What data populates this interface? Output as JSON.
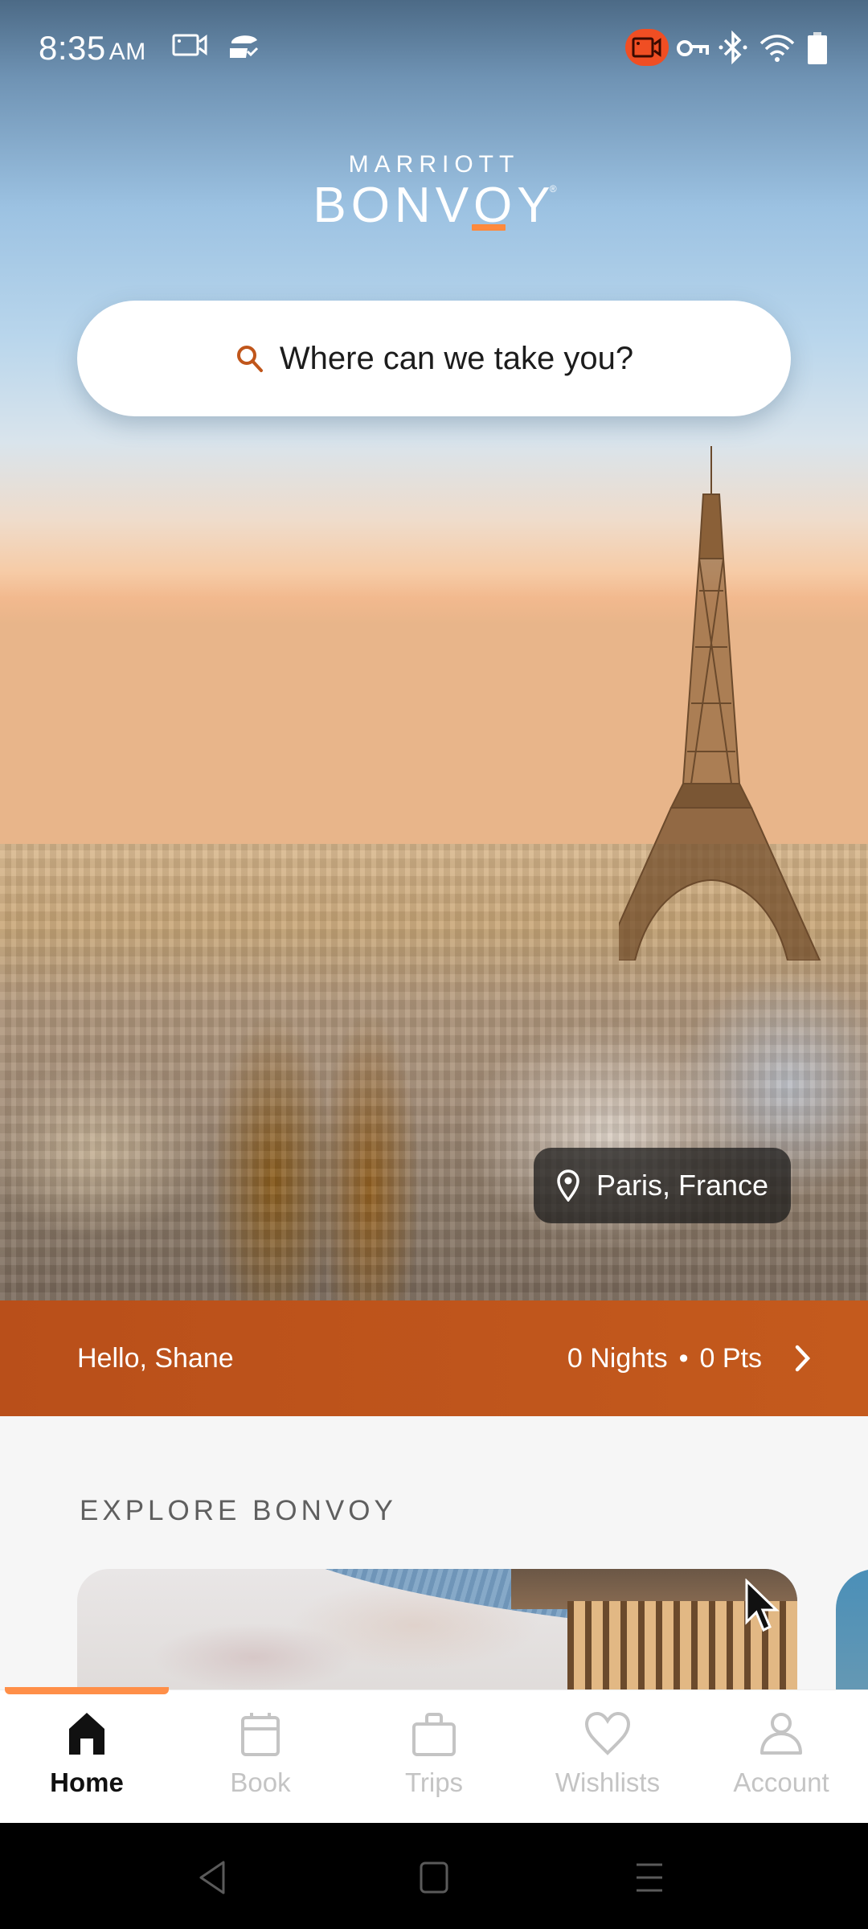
{
  "status_bar": {
    "time": "8:35",
    "ampm": "AM",
    "left_icons": [
      "screen-record-icon",
      "cloud-sync-icon"
    ],
    "right_icons": [
      "camera-recording-icon",
      "vpn-key-icon",
      "bluetooth-icon",
      "wifi-icon",
      "battery-icon"
    ],
    "recording_color": "#f04e23"
  },
  "brand": {
    "top": "MARRIOTT",
    "main": "BONVOY",
    "registered": "®",
    "accent": "#ff8a3d"
  },
  "search": {
    "placeholder": "Where can we take you?",
    "icon": "search-icon",
    "icon_color": "#c0561b"
  },
  "hero": {
    "location": "Paris, France",
    "location_icon": "map-pin-icon"
  },
  "greeting": {
    "text": "Hello, Shane",
    "nights": "0 Nights",
    "separator": "•",
    "points": "0 Pts",
    "bar_color": "#bf541c"
  },
  "explore": {
    "title": "EXPLORE BONVOY"
  },
  "bottom_nav": {
    "active_index": 0,
    "indicator_color": "#ff8f48",
    "items": [
      {
        "label": "Home",
        "icon": "home-icon"
      },
      {
        "label": "Book",
        "icon": "calendar-icon"
      },
      {
        "label": "Trips",
        "icon": "suitcase-icon"
      },
      {
        "label": "Wishlists",
        "icon": "heart-icon"
      },
      {
        "label": "Account",
        "icon": "person-icon"
      }
    ]
  },
  "system_nav": {
    "buttons": [
      "back",
      "home",
      "recents"
    ]
  }
}
